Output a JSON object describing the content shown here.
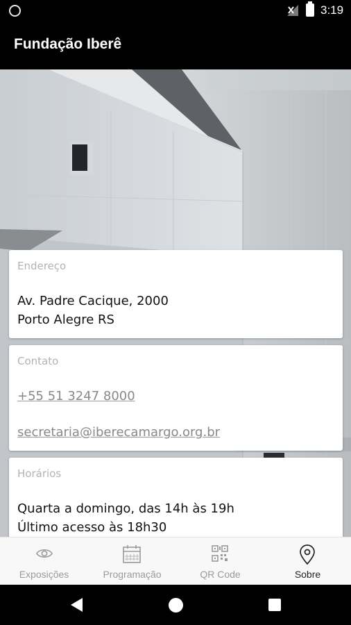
{
  "status_bar": {
    "time": "3:19",
    "icons": [
      "notification-circle-icon",
      "signal-icon",
      "battery-icon"
    ]
  },
  "app_bar": {
    "title": "Fundação Iberê"
  },
  "cards": {
    "address": {
      "label": "Endereço",
      "line1": "Av. Padre Cacique, 2000",
      "line2": "Porto Alegre RS"
    },
    "contact": {
      "label": "Contato",
      "phone": "+55 51 3247 8000",
      "email": "secretaria@iberecamargo.org.br"
    },
    "hours": {
      "label": "Horários",
      "line1": "Quarta a domingo, das 14h às 19h",
      "line2": "Último acesso às 18h30"
    }
  },
  "bottom_nav": {
    "items": [
      {
        "label": "Exposições",
        "icon": "eye-icon",
        "active": false
      },
      {
        "label": "Programação",
        "icon": "calendar-icon",
        "active": false
      },
      {
        "label": "QR Code",
        "icon": "qr-code-icon",
        "active": false
      },
      {
        "label": "Sobre",
        "icon": "location-pin-icon",
        "active": true
      }
    ]
  },
  "colors": {
    "app_bar": "#000000",
    "card_background": "#ffffff",
    "label_gray": "#b3b3b3",
    "nav_active": "#222222",
    "nav_inactive": "#9a9a9a"
  }
}
